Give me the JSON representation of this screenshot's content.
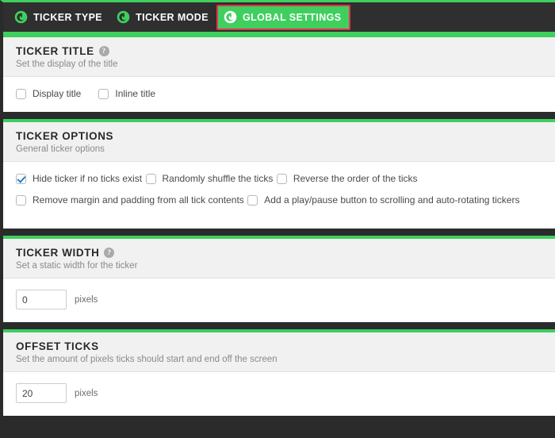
{
  "colors": {
    "accent_green": "#3ecf5e",
    "header_dark": "#2f2f2f",
    "highlight_red": "#e8334a",
    "checkbox_check": "#2a7fc9",
    "panel_head_bg": "#f1f1f1"
  },
  "tabs": [
    {
      "label": "TICKER TYPE",
      "icon": "ticker-icon",
      "active": false
    },
    {
      "label": "TICKER MODE",
      "icon": "ticker-icon",
      "active": false
    },
    {
      "label": "GLOBAL SETTINGS",
      "icon": "ticker-icon",
      "active": true
    }
  ],
  "panels": [
    {
      "title": "TICKER TITLE",
      "subtitle": "Set the display of the title",
      "has_help": true,
      "help_glyph": "?",
      "checkboxes": [
        {
          "label": "Display title",
          "checked": false
        },
        {
          "label": "Inline title",
          "checked": false
        }
      ]
    },
    {
      "title": "TICKER OPTIONS",
      "subtitle": "General ticker options",
      "has_help": false,
      "checkboxes": [
        {
          "label": "Hide ticker if no ticks exist",
          "checked": true
        },
        {
          "label": "Randomly shuffle the ticks",
          "checked": false
        },
        {
          "label": "Reverse the order of the ticks",
          "checked": false
        },
        {
          "label": "Remove margin and padding from all tick contents",
          "checked": false
        },
        {
          "label": "Add a play/pause button to scrolling and auto-rotating tickers",
          "checked": false
        }
      ]
    },
    {
      "title": "TICKER WIDTH",
      "subtitle": "Set a static width for the ticker",
      "has_help": true,
      "help_glyph": "?",
      "field": {
        "value": "0",
        "unit": "pixels"
      }
    },
    {
      "title": "OFFSET TICKS",
      "subtitle": "Set the amount of pixels ticks should start and end off the screen",
      "has_help": false,
      "field": {
        "value": "20",
        "unit": "pixels"
      }
    }
  ]
}
